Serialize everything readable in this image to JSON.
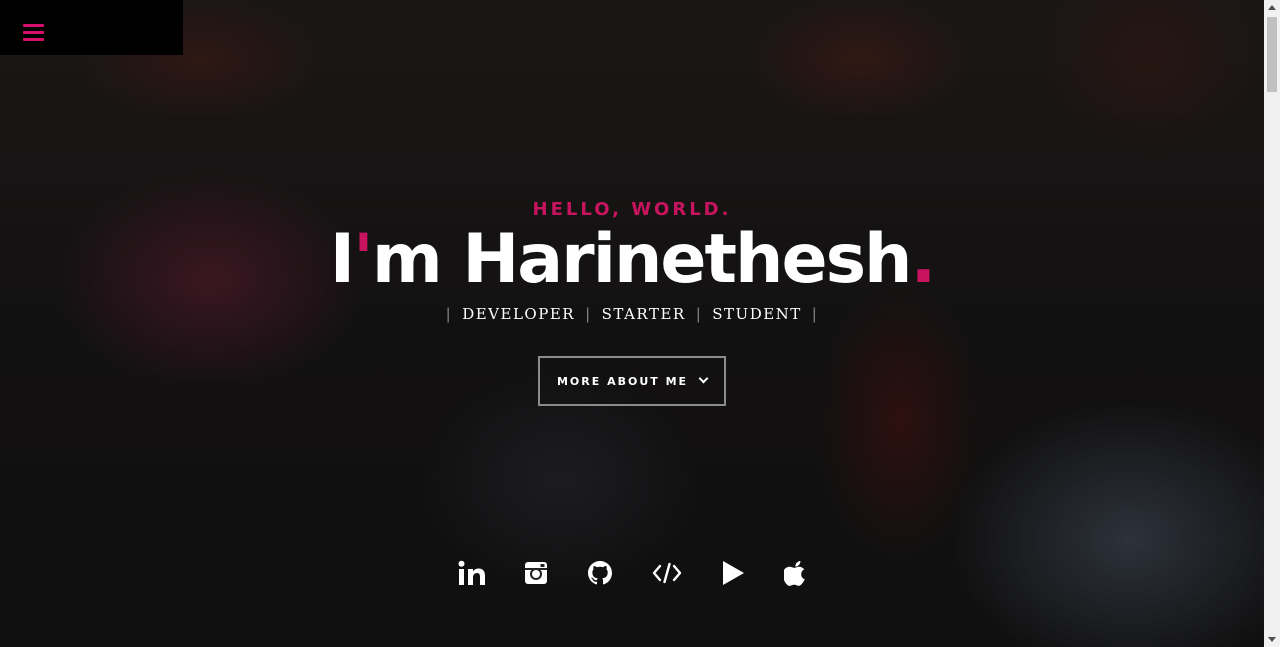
{
  "hero": {
    "greeting": "HELLO, WORLD.",
    "name_prefix": "I",
    "name_apostrophe": "'",
    "name_rest": "m Harinethesh",
    "name_dot": ".",
    "roles": [
      "DEVELOPER",
      "STARTER",
      "STUDENT"
    ],
    "separator": "|",
    "more_button": "MORE ABOUT ME"
  },
  "socials": [
    {
      "name": "linkedin-icon"
    },
    {
      "name": "instagram-icon"
    },
    {
      "name": "github-icon"
    },
    {
      "name": "code-icon"
    },
    {
      "name": "play-store-icon"
    },
    {
      "name": "apple-icon"
    }
  ],
  "colors": {
    "accent": "#c8145f",
    "menu_bg": "#000000",
    "text": "#ffffff"
  }
}
